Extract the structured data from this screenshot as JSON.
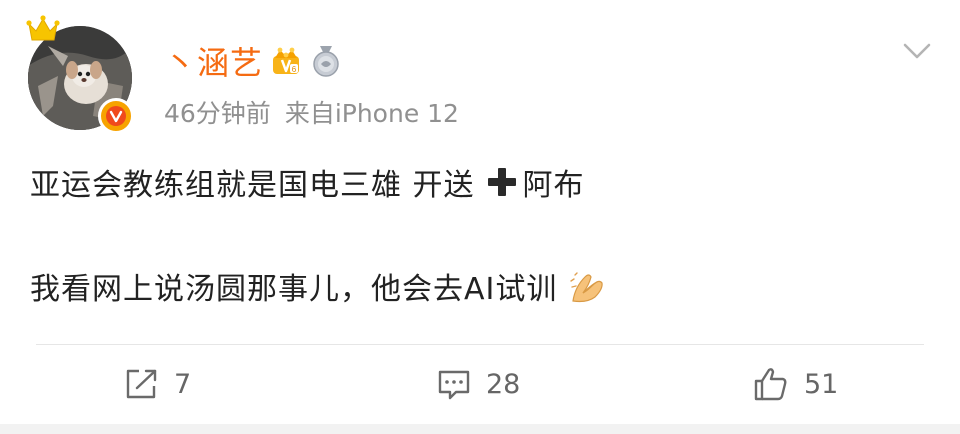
{
  "post": {
    "author": {
      "name": "丶涵艺",
      "crown_icon": "crown-icon",
      "badges": [
        "vip-crown-badge-icon",
        "medal-badge-icon"
      ],
      "verified_icon": "verified-v-icon"
    },
    "meta": {
      "time": "46分钟前",
      "source": "来自iPhone 12"
    },
    "text": {
      "line1_before": "亚运会教练组就是国电三雄 开送",
      "line1_after": "阿布",
      "line2": "我看网上说汤圆那事儿，他会去AI试训"
    },
    "icons": {
      "plus": "heavy-plus-icon",
      "pray": "folded-hands-emoji-icon",
      "more": "chevron-down-icon"
    },
    "actions": {
      "repost_count": "7",
      "comment_count": "28",
      "like_count": "51"
    }
  },
  "colors": {
    "username": "#f56b12",
    "meta": "#909090",
    "text": "#222222",
    "action": "#666666",
    "verified": "#f7a300"
  }
}
